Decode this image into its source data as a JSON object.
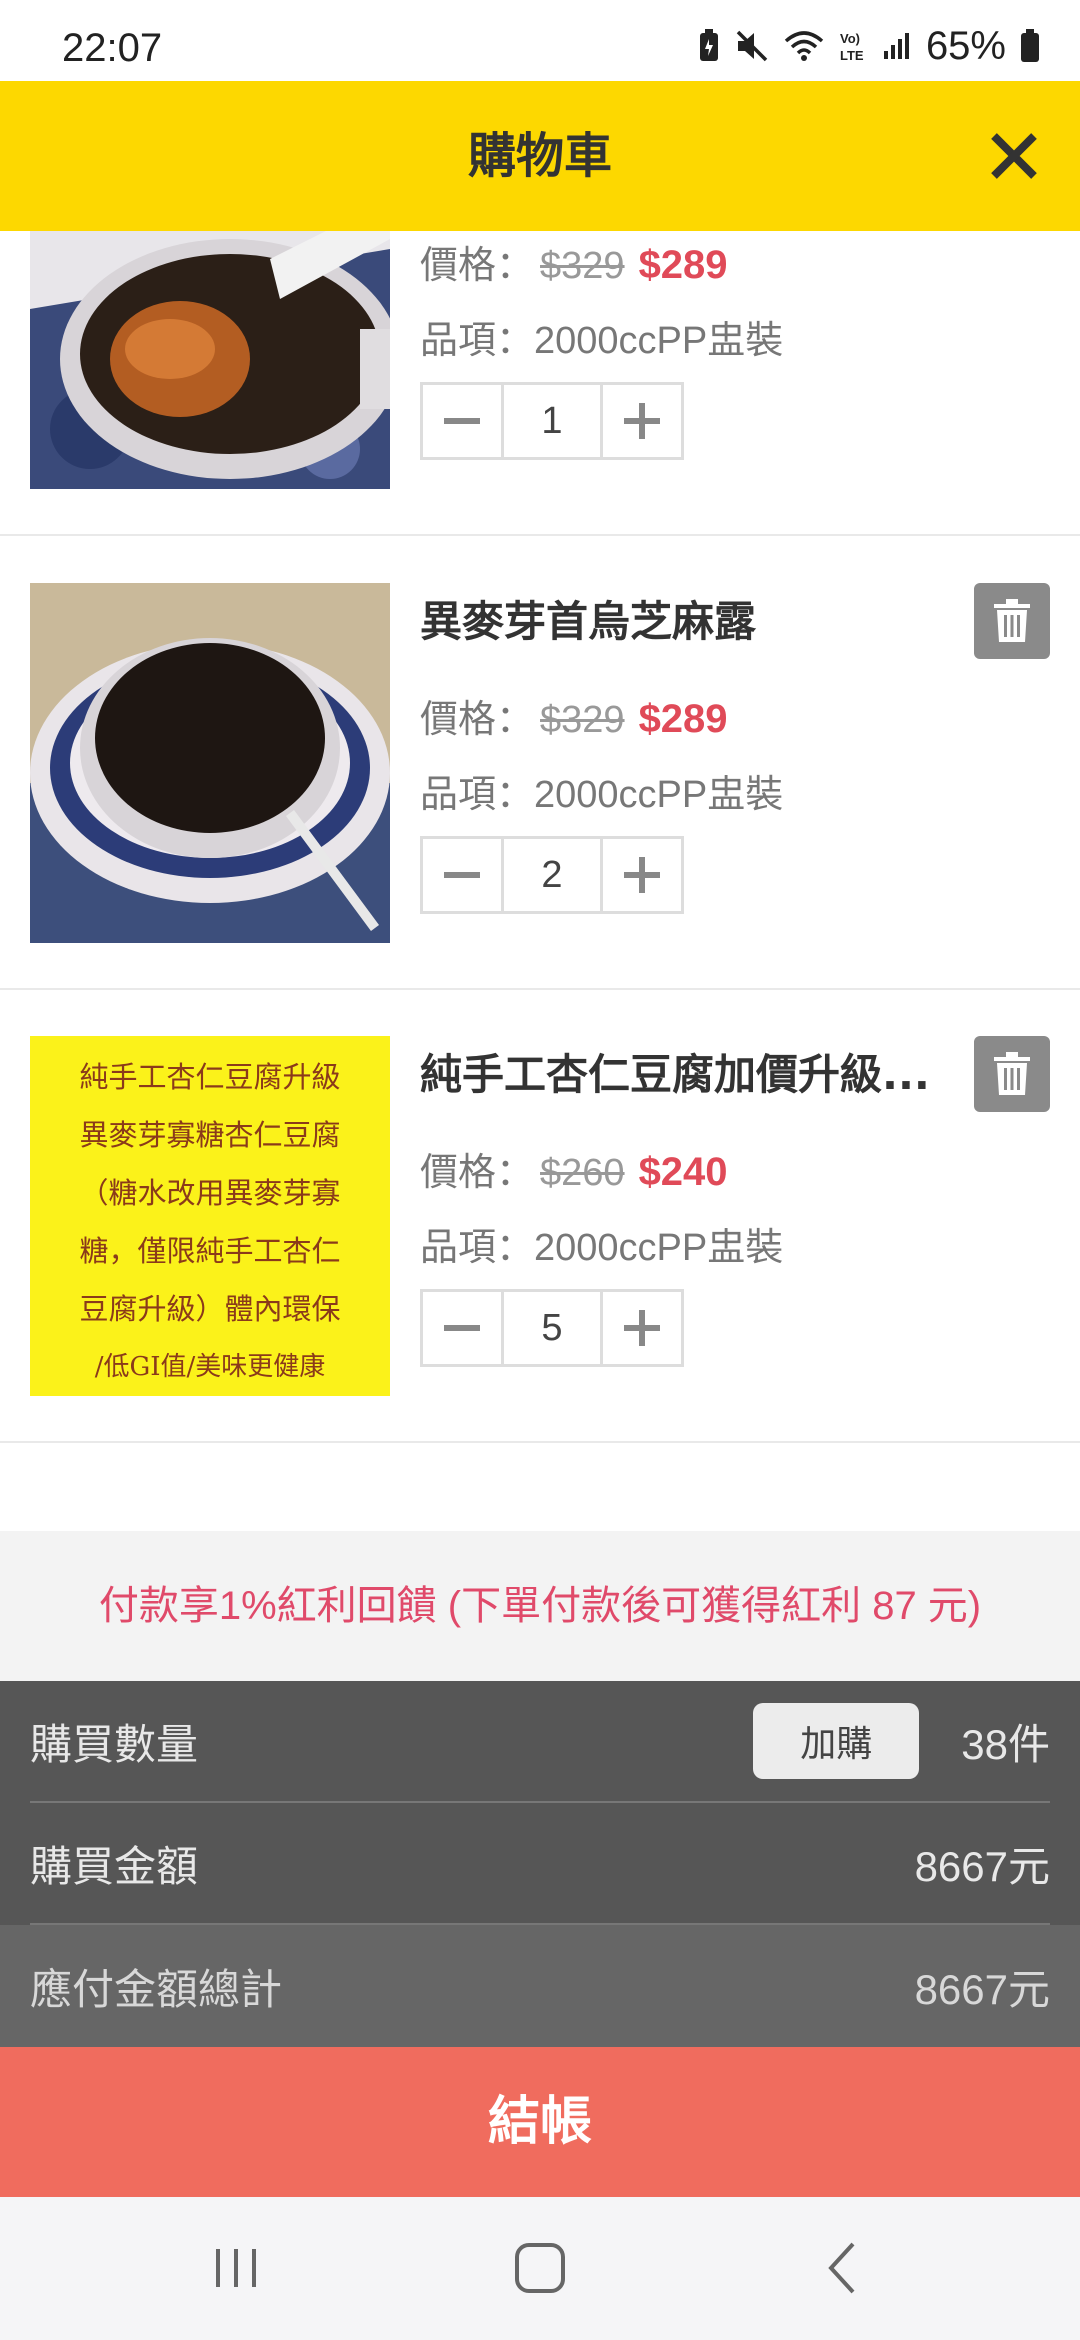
{
  "status_bar": {
    "time": "22:07",
    "battery_percent": "65%"
  },
  "header": {
    "title": "購物車"
  },
  "labels": {
    "price_prefix": "價格：",
    "variant_prefix": "品項："
  },
  "items": [
    {
      "name": "",
      "old_price": "$329",
      "new_price": "$289",
      "variant": "2000ccPP盅裝",
      "quantity": "1",
      "image": "coffee-cup-with-jelly"
    },
    {
      "name": "異麥芽首烏芝麻露",
      "old_price": "$329",
      "new_price": "$289",
      "variant": "2000ccPP盅裝",
      "quantity": "2",
      "image": "sesame-paste-bowl"
    },
    {
      "name": "純手工杏仁豆腐加價升級...",
      "old_price": "$260",
      "new_price": "$240",
      "variant": "2000ccPP盅裝",
      "quantity": "5",
      "image": "yellow-text-card",
      "image_text": [
        "純手工杏仁豆腐升級",
        "異麥芽寡糖杏仁豆腐",
        "（糖水改用異麥芽寡",
        "糖，僅限純手工杏仁",
        "豆腐升級）體內環保",
        "/低GI值/美味更健康"
      ]
    }
  ],
  "bonus": {
    "text": "付款享1%紅利回饋 (下單付款後可獲得紅利 87 元)"
  },
  "summary": {
    "qty_label": "購買數量",
    "addon_label": "加購",
    "qty_value": "38件",
    "amount_label": "購買金額",
    "amount_value": "8667元",
    "total_label": "應付金額總計",
    "total_value": "8667元"
  },
  "checkout": {
    "label": "結帳"
  },
  "colors": {
    "header_bg": "#fdd800",
    "sale_price": "#e04a58",
    "bonus_text": "#e04a6a",
    "summary_bg": "#565656",
    "checkout_bg": "#f06c5e"
  },
  "icons": [
    "close-icon",
    "trash-icon",
    "minus-icon",
    "plus-icon",
    "recents-icon",
    "home-icon",
    "back-icon"
  ]
}
